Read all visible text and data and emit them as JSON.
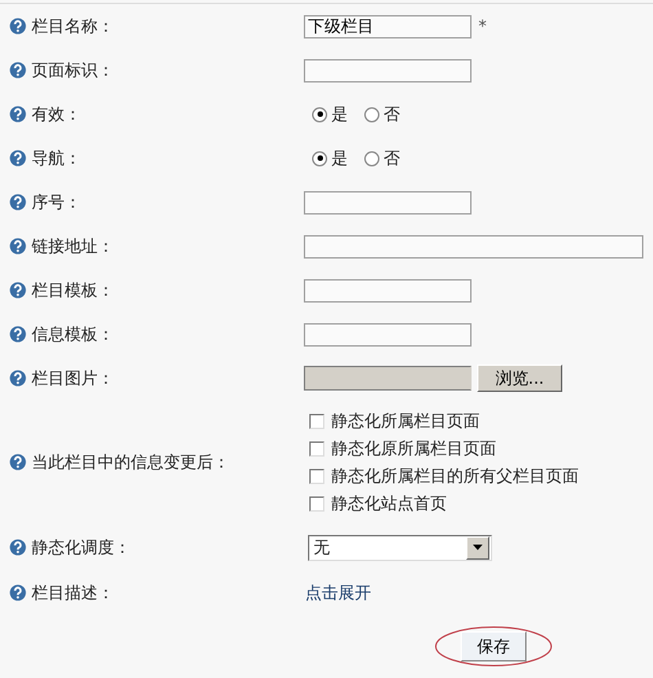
{
  "fields": [
    {
      "kind": "text",
      "label": "栏目名称：",
      "value": "下级栏目",
      "required_mark": "*"
    },
    {
      "kind": "text",
      "label": "页面标识："
    },
    {
      "kind": "radio",
      "label": "有效：",
      "options": [
        {
          "label": "是",
          "selected": true
        },
        {
          "label": "否",
          "selected": false
        }
      ]
    },
    {
      "kind": "radio",
      "label": "导航：",
      "options": [
        {
          "label": "是",
          "selected": true
        },
        {
          "label": "否",
          "selected": false
        }
      ]
    },
    {
      "kind": "text",
      "label": "序号："
    },
    {
      "kind": "wide_text",
      "label": "链接地址："
    },
    {
      "kind": "text",
      "label": "栏目模板："
    },
    {
      "kind": "text",
      "label": "信息模板："
    },
    {
      "kind": "file",
      "label": "栏目图片：",
      "button": "浏览..."
    },
    {
      "kind": "checkboxes",
      "label": "当此栏目中的信息变更后：",
      "options": [
        {
          "label": "静态化所属栏目页面",
          "checked": false
        },
        {
          "label": "静态化原所属栏目页面",
          "checked": false
        },
        {
          "label": "静态化所属栏目的所有父栏目页面",
          "checked": false
        },
        {
          "label": "静态化站点首页",
          "checked": false
        }
      ]
    },
    {
      "kind": "select",
      "label": "静态化调度：",
      "value": "无"
    },
    {
      "kind": "link",
      "label": "栏目描述：",
      "text": "点击展开"
    }
  ],
  "save_button": "保存"
}
